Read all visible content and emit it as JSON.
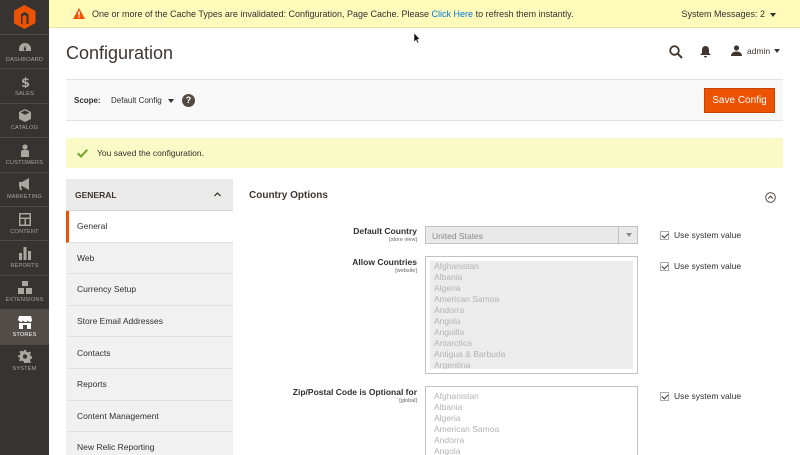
{
  "nav": {
    "items": [
      {
        "label": "DASHBOARD",
        "icon": "dashboard-icon"
      },
      {
        "label": "SALES",
        "icon": "dollar-icon"
      },
      {
        "label": "CATALOG",
        "icon": "cube-icon"
      },
      {
        "label": "CUSTOMERS",
        "icon": "person-icon"
      },
      {
        "label": "MARKETING",
        "icon": "megaphone-icon"
      },
      {
        "label": "CONTENT",
        "icon": "layout-icon"
      },
      {
        "label": "REPORTS",
        "icon": "bar-chart-icon"
      },
      {
        "label": "EXTENSIONS",
        "icon": "blocks-icon"
      },
      {
        "label": "STORES",
        "icon": "store-icon"
      },
      {
        "label": "SYSTEM",
        "icon": "gear-icon"
      }
    ]
  },
  "notice": {
    "text_before": "One or more of the Cache Types are invalidated: Configuration, Page Cache. Please ",
    "link": "Click Here",
    "text_after": " to refresh them instantly.",
    "system_messages": "System Messages: 2"
  },
  "header": {
    "title": "Configuration",
    "user": "admin"
  },
  "scope": {
    "label": "Scope:",
    "value": "Default Config",
    "help": "?",
    "save_label": "Save Config"
  },
  "message": {
    "text": "You saved the configuration."
  },
  "tabs": {
    "group": "GENERAL",
    "items": [
      "General",
      "Web",
      "Currency Setup",
      "Store Email Addresses",
      "Contacts",
      "Reports",
      "Content Management",
      "New Relic Reporting"
    ]
  },
  "section": {
    "title": "Country Options",
    "default_country": {
      "label": "Default Country",
      "scope": "[store view]",
      "value": "United States",
      "use_system": "Use system value"
    },
    "allow_countries": {
      "label": "Allow Countries",
      "scope": "[website]",
      "options": [
        "Afghanistan",
        "Albania",
        "Algeria",
        "American Samoa",
        "Andorra",
        "Angola",
        "Anguilla",
        "Antarctica",
        "Antigua & Barbuda",
        "Argentina"
      ],
      "use_system": "Use system value"
    },
    "zip_optional": {
      "label": "Zip/Postal Code is Optional for",
      "scope": "[global]",
      "options": [
        "Afghanistan",
        "Albania",
        "Algeria",
        "American Samoa",
        "Andorra",
        "Angola"
      ],
      "use_system": "Use system value"
    }
  },
  "colors": {
    "accent": "#eb5202",
    "nav_bg": "#373330",
    "notice_bg": "#fffbbb",
    "link": "#007bdb"
  }
}
